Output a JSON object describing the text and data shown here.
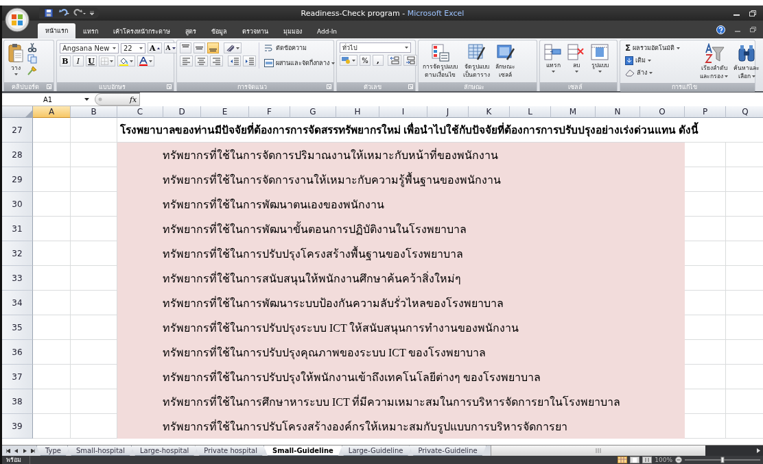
{
  "window": {
    "title": "Readiness-Check program",
    "app": "Microsoft Excel",
    "separator": "-"
  },
  "ribbon_tabs": [
    {
      "label": "หน้าแรก",
      "selected": true
    },
    {
      "label": "แทรก",
      "selected": false
    },
    {
      "label": "เค้าโครงหน้ากระดาษ",
      "selected": false
    },
    {
      "label": "สูตร",
      "selected": false
    },
    {
      "label": "ข้อมูล",
      "selected": false
    },
    {
      "label": "ตรวจทาน",
      "selected": false
    },
    {
      "label": "มุมมอง",
      "selected": false
    },
    {
      "label": "Add-In",
      "selected": false
    }
  ],
  "ribbon_groups": [
    {
      "kind": "clipboard",
      "label": "คลิปบอร์ด",
      "paste": "วาง"
    },
    {
      "kind": "font",
      "label": "แบบอักษร",
      "font_name": "Angsana New",
      "font_size": "22",
      "grow": "A",
      "shrink": "A",
      "styles": [
        "B",
        "I",
        "U"
      ]
    },
    {
      "kind": "alignment",
      "label": "การจัดแนว",
      "vertical_align": [
        {
          "kind": "top",
          "on": false
        },
        {
          "kind": "middle",
          "on": false
        },
        {
          "kind": "bottom",
          "on": true
        }
      ],
      "wrap": "ตัดข้อความ",
      "merge": "ผสานและจัดกึ่งกลาง"
    },
    {
      "kind": "number",
      "label": "ตัวเลข",
      "format": "ทั่วไป",
      "percent": "%",
      "comma": ","
    },
    {
      "kind": "styles",
      "label": "ลักษณะ",
      "buttons": [
        [
          "การจัดรูปแบบ",
          "ตามเงื่อนไข"
        ],
        [
          "จัดรูปแบบ",
          "เป็นตาราง"
        ],
        [
          "ลักษณะ",
          "เซลล์"
        ]
      ]
    },
    {
      "kind": "cells",
      "label": "เซลล์",
      "buttons": [
        "แทรก",
        "ลบ",
        "รูปแบบ"
      ]
    },
    {
      "kind": "editing",
      "label": "การแก้ไข",
      "sigma": "Σ",
      "autosum": "ผลรวมอัตโนมัติ",
      "fill": "เติม",
      "clear": "ล้าง",
      "buttons": [
        [
          "เรียงลำดับ",
          "และกรอง"
        ],
        [
          "ค้นหาและ",
          "เลือก"
        ]
      ]
    }
  ],
  "formula_bar": {
    "name_box": "A1",
    "fx": "fx"
  },
  "columns": [
    {
      "label": "A",
      "selected": true
    },
    {
      "label": "B",
      "selected": false
    },
    {
      "label": "C",
      "selected": false
    },
    {
      "label": "D",
      "selected": false
    },
    {
      "label": "E",
      "selected": false
    },
    {
      "label": "F",
      "selected": false
    },
    {
      "label": "G",
      "selected": false
    },
    {
      "label": "H",
      "selected": false
    },
    {
      "label": "I",
      "selected": false
    },
    {
      "label": "J",
      "selected": false
    },
    {
      "label": "K",
      "selected": false
    },
    {
      "label": "L",
      "selected": false
    },
    {
      "label": "M",
      "selected": false
    },
    {
      "label": "N",
      "selected": false
    },
    {
      "label": "O",
      "selected": false
    },
    {
      "label": "P",
      "selected": false
    },
    {
      "label": "Q",
      "selected": false
    }
  ],
  "rows": [
    {
      "number": "27",
      "kind": "heading",
      "text": "โรงพยาบาลของท่านมีปัจจัยที่ต้องการการจัดสรรทรัพยากรใหม่ เพื่อนำไปใช้กับปัจจัยที่ต้องการการปรับปรุงอย่างเร่งด่วนแทน ดังนี้"
    },
    {
      "number": "28",
      "kind": "item",
      "text": "ทรัพยากรที่ใช้ในการจัดการปริมาณงานให้เหมาะกับหน้าที่ของพนักงาน"
    },
    {
      "number": "29",
      "kind": "item",
      "text": "ทรัพยากรที่ใช้ในการจัดการงานให้เหมาะกับความรู้พื้นฐานของพนักงาน"
    },
    {
      "number": "30",
      "kind": "item",
      "text": "ทรัพยากรที่ใช้ในการพัฒนาตนเองของพนักงาน"
    },
    {
      "number": "31",
      "kind": "item",
      "text": "ทรัพยากรที่ใช้ในการพัฒนาขั้นตอนการปฏิบัติงานในโรงพยาบาล"
    },
    {
      "number": "32",
      "kind": "item",
      "text": "ทรัพยากรที่ใช้ในการปรับปรุงโครงสร้างพื้นฐานของโรงพยาบาล"
    },
    {
      "number": "33",
      "kind": "item",
      "text": "ทรัพยากรที่ใช้ในการสนับสนุนให้พนักงานศึกษาค้นคว้าสิ่งใหม่ๆ"
    },
    {
      "number": "34",
      "kind": "item",
      "text": "ทรัพยากรที่ใช้ในการพัฒนาระบบป้องกันความลับรั่วไหลของโรงพยาบาล"
    },
    {
      "number": "35",
      "kind": "item",
      "text": "ทรัพยากรที่ใช้ในการปรับปรุงระบบ ICT ให้สนับสนุนการทำงานของพนักงาน"
    },
    {
      "number": "36",
      "kind": "item",
      "text": "ทรัพยากรที่ใช้ในการปรับปรุงคุณภาพของระบบ ICT ของโรงพยาบาล"
    },
    {
      "number": "37",
      "kind": "item",
      "text": "ทรัพยากรที่ใช้ในการปรับปรุงให้พนักงานเข้าถึงเทคโนโลยีต่างๆ ของโรงพยาบาล"
    },
    {
      "number": "38",
      "kind": "item",
      "text": "ทรัพยากรที่ใช้ในการศึกษาหาระบบ ICT ที่มีความเหมาะสมในการบริหารจัดการยาในโรงพยาบาล"
    },
    {
      "number": "39",
      "kind": "item",
      "text": "ทรัพยากรที่ใช้ในการปรับโครงสร้างองค์กรให้เหมาะสมกับรูปแบบการบริหารจัดการยา"
    }
  ],
  "sheet_tabs": [
    {
      "label": "Type",
      "selected": false
    },
    {
      "label": "Small-hospital",
      "selected": false
    },
    {
      "label": "Large-hospital",
      "selected": false
    },
    {
      "label": "Private hospital",
      "selected": false
    },
    {
      "label": "Small-Guideline",
      "selected": true
    },
    {
      "label": "Large-Guideline",
      "selected": false
    },
    {
      "label": "Private-Guideline",
      "selected": false
    }
  ],
  "status_bar": {
    "mode": "พร้อม",
    "zoom": "100%"
  }
}
